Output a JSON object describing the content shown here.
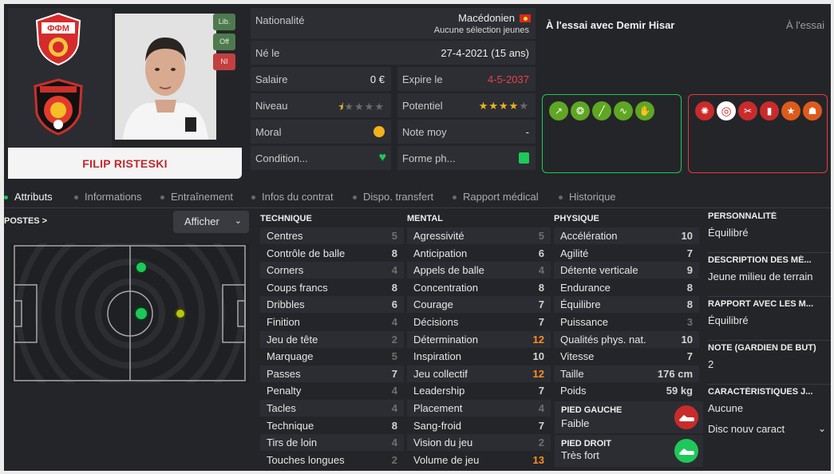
{
  "player": {
    "name": "FILIP RISTESKI",
    "roles": [
      "Lib.",
      "Off",
      "NI"
    ]
  },
  "info": {
    "nationality_label": "Nationalité",
    "nationality_value": "Macédonien",
    "nationality_sub": "Aucune sélection jeunes",
    "born_label": "Né le",
    "born_value": "27-4-2021 (15 ans)",
    "salary_label": "Salaire",
    "salary_value": "0 €",
    "expire_label": "Expire le",
    "expire_value": "4-5-2037",
    "level_label": "Niveau",
    "level_stars": 0.5,
    "potential_label": "Potentiel",
    "potential_stars": 4,
    "morale_label": "Moral",
    "avg_label": "Note moy",
    "avg_value": "-",
    "condition_label": "Condition...",
    "form_label": "Forme ph..."
  },
  "trial": {
    "title": "À l'essai avec Demir Hisar",
    "status": "À l'essai"
  },
  "traits_good": [
    "trend-up-icon",
    "brain-icon",
    "bandage-icon",
    "heartbeat-icon",
    "handshake-icon"
  ],
  "traits_bad": [
    "virus-icon",
    "target-icon",
    "injury-icon",
    "card-icon",
    "star-icon",
    "foot-icon"
  ],
  "tabs": [
    "Attributs",
    "Informations",
    "Entraînement",
    "Infos du contrat",
    "Dispo. transfert",
    "Rapport médical",
    "Historique"
  ],
  "positions": {
    "title": "POSTES >",
    "show_label": "Afficher"
  },
  "technique": {
    "title": "TECHNIQUE",
    "items": [
      {
        "name": "Centres",
        "value": "5"
      },
      {
        "name": "Contrôle de balle",
        "value": "8"
      },
      {
        "name": "Corners",
        "value": "4"
      },
      {
        "name": "Coups francs",
        "value": "8"
      },
      {
        "name": "Dribbles",
        "value": "6"
      },
      {
        "name": "Finition",
        "value": "4"
      },
      {
        "name": "Jeu de tête",
        "value": "2"
      },
      {
        "name": "Marquage",
        "value": "5"
      },
      {
        "name": "Passes",
        "value": "7"
      },
      {
        "name": "Penalty",
        "value": "4"
      },
      {
        "name": "Tacles",
        "value": "4"
      },
      {
        "name": "Technique",
        "value": "8"
      },
      {
        "name": "Tirs de loin",
        "value": "4"
      },
      {
        "name": "Touches longues",
        "value": "2"
      }
    ]
  },
  "mental": {
    "title": "MENTAL",
    "items": [
      {
        "name": "Agressivité",
        "value": "5"
      },
      {
        "name": "Anticipation",
        "value": "6"
      },
      {
        "name": "Appels de balle",
        "value": "4"
      },
      {
        "name": "Concentration",
        "value": "8"
      },
      {
        "name": "Courage",
        "value": "7"
      },
      {
        "name": "Décisions",
        "value": "7"
      },
      {
        "name": "Détermination",
        "value": "12"
      },
      {
        "name": "Inspiration",
        "value": "10"
      },
      {
        "name": "Jeu collectif",
        "value": "12"
      },
      {
        "name": "Leadership",
        "value": "7"
      },
      {
        "name": "Placement",
        "value": "4"
      },
      {
        "name": "Sang-froid",
        "value": "7"
      },
      {
        "name": "Vision du jeu",
        "value": "2"
      },
      {
        "name": "Volume de jeu",
        "value": "13"
      }
    ]
  },
  "physique": {
    "title": "PHYSIQUE",
    "items": [
      {
        "name": "Accélération",
        "value": "10"
      },
      {
        "name": "Agilité",
        "value": "7"
      },
      {
        "name": "Détente verticale",
        "value": "9"
      },
      {
        "name": "Endurance",
        "value": "8"
      },
      {
        "name": "Équilibre",
        "value": "8"
      },
      {
        "name": "Puissance",
        "value": "3"
      },
      {
        "name": "Qualités phys. nat.",
        "value": "10"
      },
      {
        "name": "Vitesse",
        "value": "7"
      },
      {
        "name": "Taille",
        "value": "176 cm"
      },
      {
        "name": "Poids",
        "value": "59 kg"
      }
    ],
    "left_foot_label": "PIED GAUCHE",
    "left_foot_value": "Faible",
    "right_foot_label": "PIED DROIT",
    "right_foot_value": "Très fort"
  },
  "side": {
    "personality_label": "PERSONNALITÉ",
    "personality_value": "Équilibré",
    "description_label": "DESCRIPTION DES MÉ...",
    "description_value": "Jeune milieu de terrain",
    "relation_label": "RAPPORT AVEC LES M...",
    "relation_value": "Équilibré",
    "gk_label": "NOTE (GARDIEN DE BUT)",
    "gk_value": "2",
    "char_label": "CARACTÉRISTIQUES J...",
    "char_value": "Aucune",
    "char_extra": "Disc nouv caract"
  },
  "colors": {
    "accent_green": "#1ec85a",
    "accent_red": "#c0272d",
    "highlight_orange": "#ff8f1f",
    "star_gold": "#e6b422"
  }
}
